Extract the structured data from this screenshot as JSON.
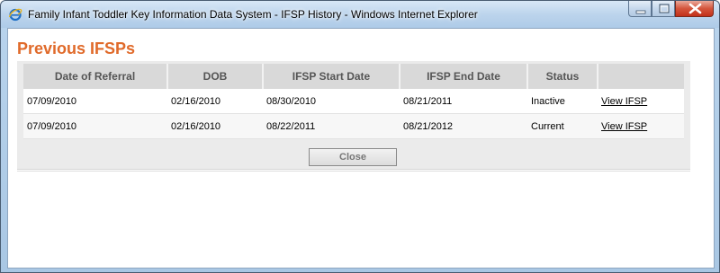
{
  "window": {
    "title": "Family Infant Toddler Key Information Data System - IFSP History - Windows Internet Explorer"
  },
  "page": {
    "heading": "Previous IFSPs"
  },
  "table": {
    "headers": [
      "Date of Referral",
      "DOB",
      "IFSP Start Date",
      "IFSP End Date",
      "Status",
      ""
    ],
    "rows": [
      {
        "date_of_referral": "07/09/2010",
        "dob": "02/16/2010",
        "start": "08/30/2010",
        "end": "08/21/2011",
        "status": "Inactive",
        "action": "View IFSP"
      },
      {
        "date_of_referral": "07/09/2010",
        "dob": "02/16/2010",
        "start": "08/22/2011",
        "end": "08/21/2012",
        "status": "Current",
        "action": "View IFSP"
      }
    ]
  },
  "buttons": {
    "close_label": "Close"
  },
  "colors": {
    "heading": "#e06a2a",
    "header_bg": "#d9d9d9",
    "panel_bg": "#ebebeb"
  },
  "icons": {
    "browser": "ie-icon",
    "minimize": "minimize-icon",
    "maximize": "maximize-icon",
    "close": "close-icon"
  }
}
